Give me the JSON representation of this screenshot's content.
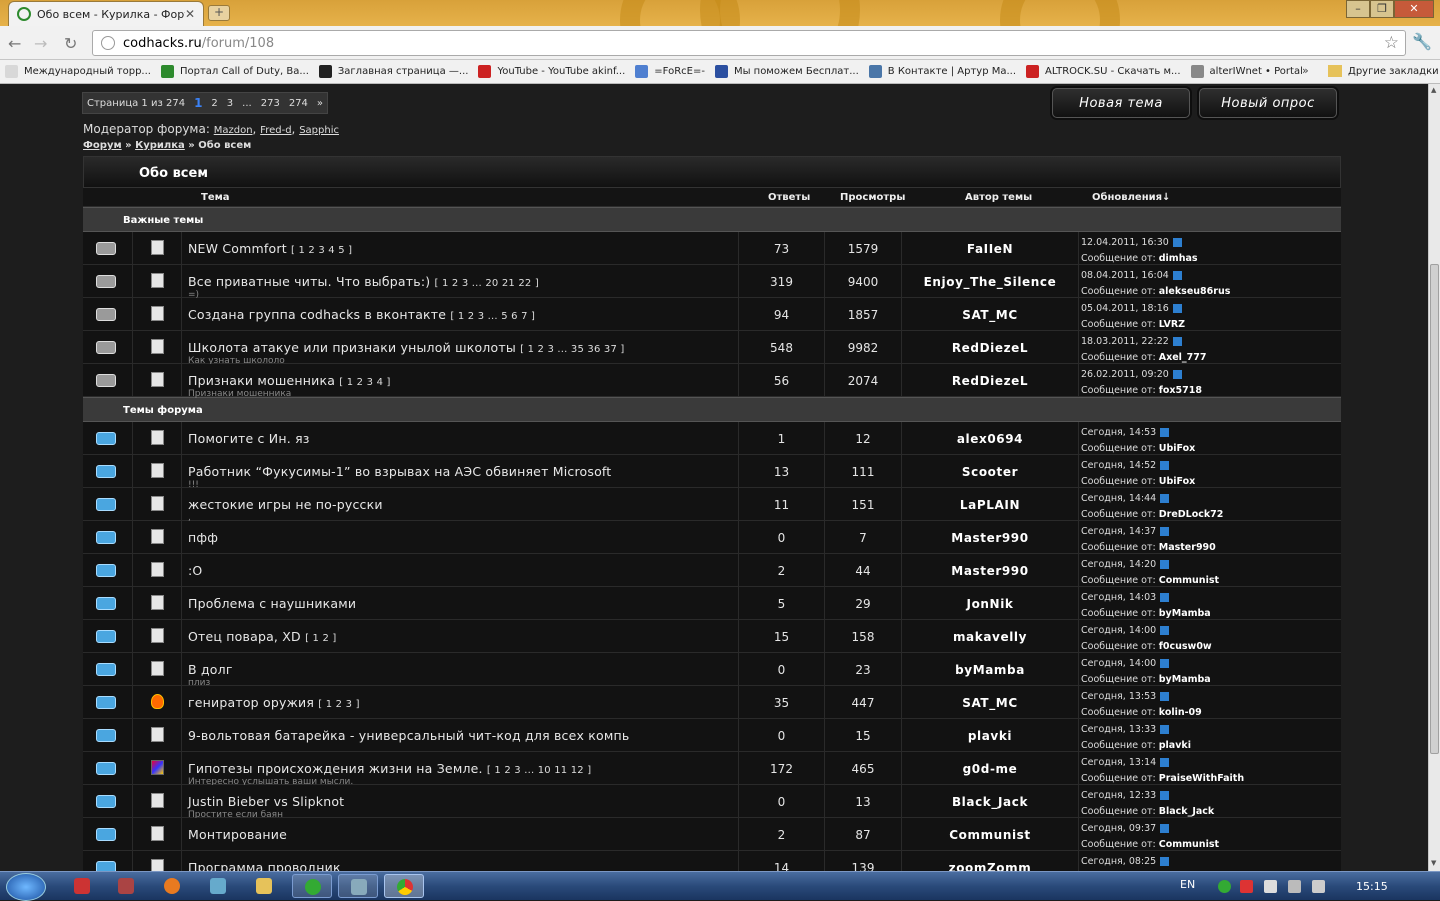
{
  "browser": {
    "tab_title": "Обо всем - Курилка - Форум",
    "url_host": "codhacks.ru",
    "url_path": "/forum/108",
    "window_controls": [
      "–",
      "❐",
      "✕"
    ]
  },
  "bookmarks": [
    {
      "label": "Международный торр...",
      "color": "#d8d8d8"
    },
    {
      "label": "Портал Call of Duty, Ba...",
      "color": "#2d8a2d"
    },
    {
      "label": "Заглавная страница —...",
      "color": "#222222"
    },
    {
      "label": "YouTube - YouTube akinf...",
      "color": "#cc2222"
    },
    {
      "label": "=FoRcE=-",
      "color": "#4f7fd0"
    },
    {
      "label": "Мы поможем Бесплат...",
      "color": "#2b4fa0"
    },
    {
      "label": "В Контакте | Артур Ма...",
      "color": "#4a76a8"
    },
    {
      "label": "ALTROCK.SU - Скачать м...",
      "color": "#cc2222"
    },
    {
      "label": "alterIWnet • Portal",
      "color": "#888888"
    }
  ],
  "bookmarks_other": "Другие закладки",
  "pager": {
    "label": "Страница 1 из 274",
    "current": "1",
    "pages": [
      "2",
      "3",
      "...",
      "273",
      "274",
      "»"
    ]
  },
  "buttons": {
    "new_topic": "Новая тема",
    "new_poll": "Новый опрос"
  },
  "moderators": {
    "label": "Модератор форума:",
    "names": [
      "Mazdon",
      "Fred-d",
      "Sapphic"
    ]
  },
  "breadcrumbs": {
    "forum": "Форум",
    "sep": "»",
    "sub": "Курилка",
    "current": "Обо всем"
  },
  "forum_title": "Обо всем",
  "columns": {
    "topic": "Тема",
    "replies": "Ответы",
    "views": "Просмотры",
    "author": "Автор темы",
    "updates": "Обновления↓"
  },
  "sections": {
    "important": "Важные темы",
    "forum": "Темы форума"
  },
  "message_from": "Сообщение от:",
  "important_topics": [
    {
      "title": "NEW Commfort",
      "pages": "[ 1 2 3 4 5 ]",
      "sub": "",
      "replies": "73",
      "views": "1579",
      "author": "FaIIeN",
      "date": "12.04.2011, 16:30",
      "last": "dimhas"
    },
    {
      "title": "Все приватные читы. Что выбрать:)",
      "pages": "[ 1 2 3 ... 20 21 22 ]",
      "sub": "=)",
      "replies": "319",
      "views": "9400",
      "author": "Enjoy_The_Silence",
      "date": "08.04.2011, 16:04",
      "last": "alekseu86rus"
    },
    {
      "title": "Создана группа codhacks в вконтакте",
      "pages": "[ 1 2 3 ... 5 6 7 ]",
      "sub": "",
      "replies": "94",
      "views": "1857",
      "author": "SAT_MC",
      "date": "05.04.2011, 18:16",
      "last": "LVRZ"
    },
    {
      "title": "Школота атакуе или признаки унылой школоты",
      "pages": "[ 1 2 3 ... 35 36 37 ]",
      "sub": "Как узнать школоло",
      "replies": "548",
      "views": "9982",
      "author": "RedDiezeL",
      "date": "18.03.2011, 22:22",
      "last": "Axel_777"
    },
    {
      "title": "Признаки мошенника",
      "pages": "[ 1 2 3 4 ]",
      "sub": "Признаки мошенника",
      "replies": "56",
      "views": "2074",
      "author": "RedDiezeL",
      "date": "26.02.2011, 09:20",
      "last": "fox5718"
    }
  ],
  "topics": [
    {
      "icon": "doc",
      "title": "Помогите с Ин. яз",
      "pages": "",
      "sub": "",
      "replies": "1",
      "views": "12",
      "author": "alex0694",
      "date": "Сегодня, 14:53",
      "last": "UbiFox"
    },
    {
      "icon": "doc",
      "title": "Работник “Фукусимы-1” во взрывах на АЭС обвиняет Microsoft",
      "pages": "",
      "sub": "!!!",
      "replies": "13",
      "views": "111",
      "author": "Scooter",
      "date": "Сегодня, 14:52",
      "last": "UbiFox"
    },
    {
      "icon": "doc",
      "title": "жестокие игры не по-русски",
      "pages": "",
      "sub": ",",
      "replies": "11",
      "views": "151",
      "author": "LaPLAIN",
      "date": "Сегодня, 14:44",
      "last": "DreDLock72"
    },
    {
      "icon": "doc",
      "title": "пфф",
      "pages": "",
      "sub": "",
      "replies": "0",
      "views": "7",
      "author": "Master990",
      "date": "Сегодня, 14:37",
      "last": "Master990"
    },
    {
      "icon": "doc",
      "title": ":O",
      "pages": "",
      "sub": "",
      "replies": "2",
      "views": "44",
      "author": "Master990",
      "date": "Сегодня, 14:20",
      "last": "Communist"
    },
    {
      "icon": "doc",
      "title": "Проблема с наушниками",
      "pages": "",
      "sub": "",
      "replies": "5",
      "views": "29",
      "author": "JonNik",
      "date": "Сегодня, 14:03",
      "last": "byMamba"
    },
    {
      "icon": "doc",
      "title": "Отец повара, XD",
      "pages": "[ 1 2 ]",
      "sub": "",
      "replies": "15",
      "views": "158",
      "author": "makavelly",
      "date": "Сегодня, 14:00",
      "last": "f0cusw0w"
    },
    {
      "icon": "doc",
      "title": "В долг",
      "pages": "",
      "sub": "плиз",
      "replies": "0",
      "views": "23",
      "author": "byMamba",
      "date": "Сегодня, 14:00",
      "last": "byMamba"
    },
    {
      "icon": "fire",
      "title": "гениратор оружия",
      "pages": "[ 1 2 3 ]",
      "sub": "",
      "replies": "35",
      "views": "447",
      "author": "SAT_MC",
      "date": "Сегодня, 13:53",
      "last": "kolin-09"
    },
    {
      "icon": "doc",
      "title": "9-вольтовая батарейка - универсальный чит-код для всех компь",
      "pages": "",
      "sub": "",
      "replies": "0",
      "views": "15",
      "author": "plavki",
      "date": "Сегодня, 13:33",
      "last": "plavki"
    },
    {
      "icon": "cube",
      "title": "Гипотезы происхождения жизни на Земле.",
      "pages": "[ 1 2 3 ... 10 11 12 ]",
      "sub": "Интересно услышать ваши мысли.",
      "replies": "172",
      "views": "465",
      "author": "g0d-me",
      "date": "Сегодня, 13:14",
      "last": "PraiseWithFaith"
    },
    {
      "icon": "doc",
      "title": "Justin Bieber vs Slipknot",
      "pages": "",
      "sub": "Простите если баян",
      "replies": "0",
      "views": "13",
      "author": "Black_Jack",
      "date": "Сегодня, 12:33",
      "last": "Black_Jack"
    },
    {
      "icon": "doc",
      "title": "Монтирование",
      "pages": "",
      "sub": "",
      "replies": "2",
      "views": "87",
      "author": "Communist",
      "date": "Сегодня, 09:37",
      "last": "Communist"
    },
    {
      "icon": "doc",
      "title": "Программа проводник",
      "pages": "",
      "sub": "",
      "replies": "14",
      "views": "139",
      "author": "zoomZomm",
      "date": "Сегодня, 08:25",
      "last": ""
    }
  ],
  "taskbar": {
    "lang": "EN",
    "clock": "15:15"
  }
}
